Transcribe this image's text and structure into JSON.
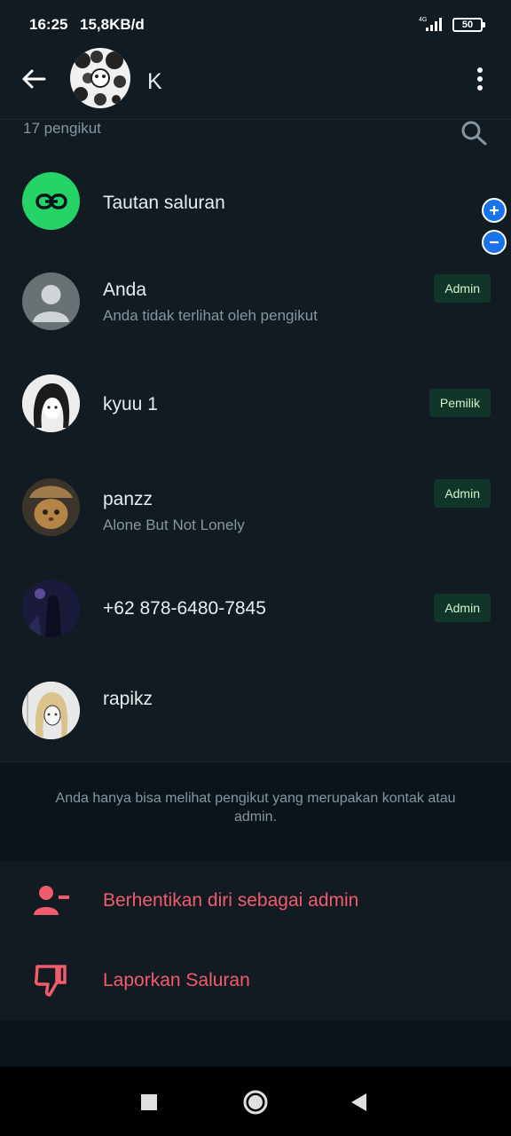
{
  "status_bar": {
    "time": "16:25",
    "speed": "15,8KB/d",
    "network": "4G",
    "battery": "50"
  },
  "header": {
    "back_icon": "arrow-left-icon",
    "channel_name": "K",
    "menu_icon": "more-vertical-icon"
  },
  "followers": {
    "count_label": "17 pengikut",
    "search_icon": "search-icon"
  },
  "channel_link": {
    "label": "Tautan saluran",
    "icon": "link-icon",
    "accent": "#25d366"
  },
  "members": [
    {
      "name": "Anda",
      "subtitle": "Anda tidak terlihat oleh pengikut",
      "role": "Admin"
    },
    {
      "name": "kyuu 1",
      "subtitle": "",
      "role": "Pemilik"
    },
    {
      "name": "panzz",
      "subtitle": "Alone But Not Lonely",
      "role": "Admin"
    },
    {
      "name": "+62 878-6480-7845",
      "subtitle": "",
      "role": "Admin"
    },
    {
      "name": "rapikz",
      "subtitle": "",
      "role": ""
    }
  ],
  "footer_note": "Anda hanya bisa melihat pengikut yang merupakan kontak atau admin.",
  "actions": [
    {
      "label": "Berhentikan diri sebagai admin",
      "icon": "remove-person-icon"
    },
    {
      "label": "Laporkan Saluran",
      "icon": "thumbs-down-icon"
    }
  ],
  "zoom_controls": {
    "plus_icon": "plus-icon",
    "minus_icon": "minus-icon"
  },
  "nav_bar": {
    "recents_icon": "square-icon",
    "home_icon": "circle-icon",
    "back_icon": "triangle-back-icon"
  },
  "colors": {
    "background": "#0b141a",
    "panel": "#111b21",
    "badge_bg": "#103529",
    "danger": "#f15c6d",
    "zoom_blue": "#1a73e8"
  }
}
